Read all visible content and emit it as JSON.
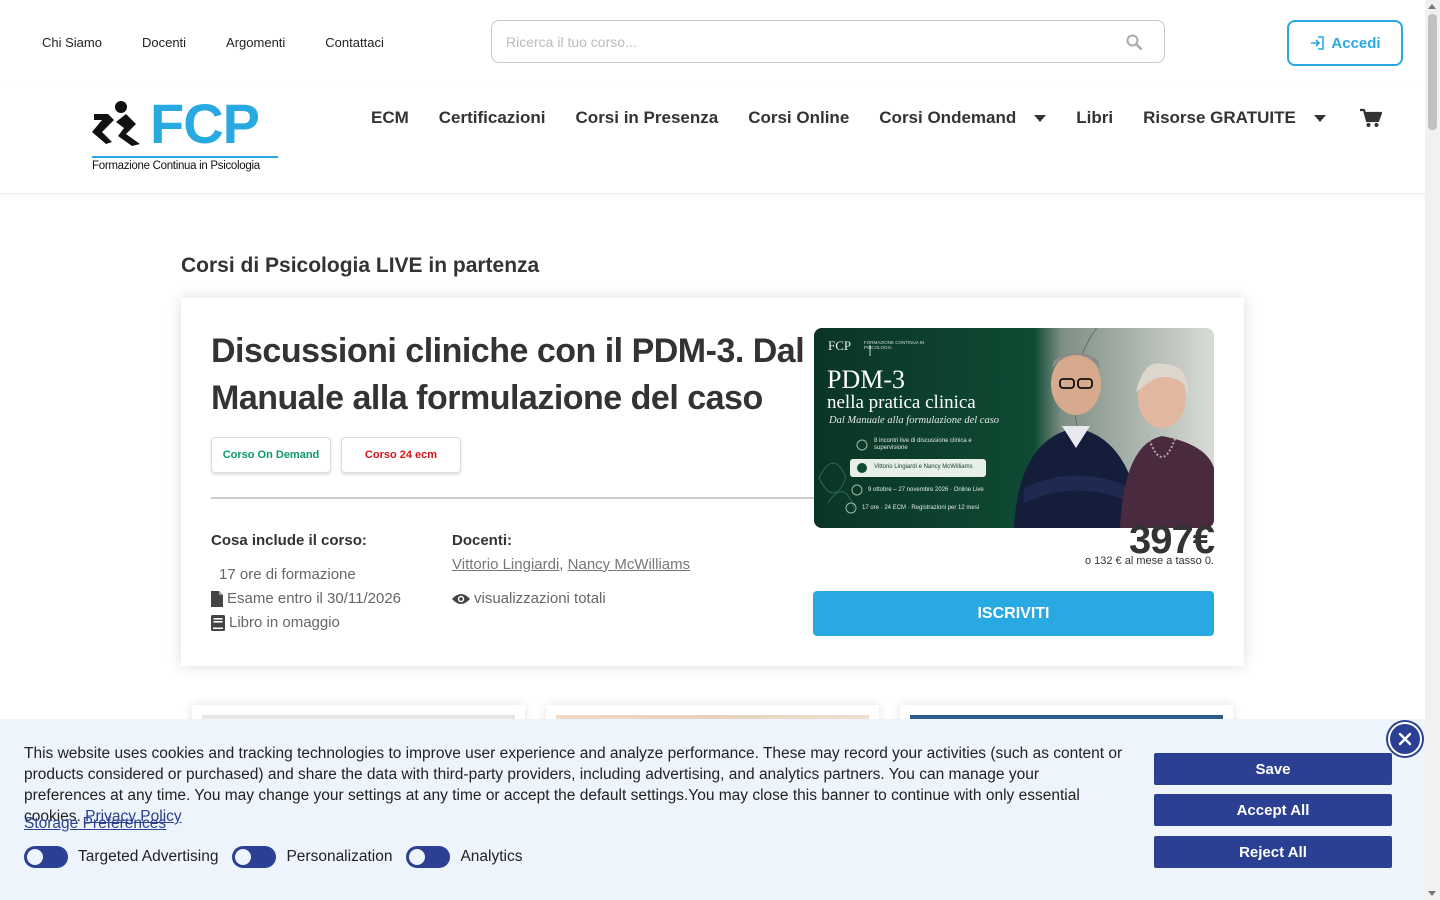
{
  "toplinks": [
    "Chi Siamo",
    "Docenti",
    "Argomenti",
    "Contattaci"
  ],
  "search": {
    "placeholder": "Ricerca il tuo corso..."
  },
  "account": {
    "login_label": "Accedi"
  },
  "logo": {
    "wordmark": "FCP",
    "tagline": "Formazione Continua in Psicologia"
  },
  "nav": {
    "ecm": "ECM",
    "certificazioni": "Certificazioni",
    "presenza": "Corsi in Presenza",
    "online": "Corsi Online",
    "ondemand": "Corsi Ondemand",
    "libri": "Libri",
    "risorse": "Risorse GRATUITE"
  },
  "section": {
    "title": "Corsi di Psicologia LIVE in partenza"
  },
  "course": {
    "title": "Discussioni cliniche con il PDM-3. Dal Manuale alla formulazione del caso",
    "badge_type": "Corso On Demand",
    "badge_ecm": "Corso 24 ecm",
    "includes_heading": "Cosa include il corso:",
    "hours": "17 ore di formazione",
    "exam": "Esame entro il 30/11/2026",
    "book": "Libro in omaggio",
    "teachers_heading": "Docenti:",
    "teacher1": "Vittorio Lingiardi",
    "teacher_sep": ", ",
    "teacher2": "Nancy McWilliams",
    "views": "visualizzazioni totali",
    "price": "397€",
    "installment": "o 132 € al mese a tasso 0.",
    "cta": "ISCRIVITI",
    "image": {
      "brand": "FCP",
      "brand_sub": "FORMAZIONE CONTINUA IN PSICOLOGIA",
      "headline1": "PDM-3",
      "headline2": "nella pratica clinica",
      "subtitle": "Dal Manuale alla formulazione del caso",
      "line1": "8 incontri live di discussione clinica e supervisione",
      "line2": "Vittorio Lingiardi e Nancy McWilliams",
      "line3": "9 ottobre – 27 novembre 2026 · Online Live",
      "line4": "17 ore · 24 ECM · Registrazioni per 12 mesi"
    }
  },
  "cookie": {
    "text": "This website uses cookies and tracking technologies to improve user experience and analyze performance. These may record your activities (such as content or products considered or purchased) and share the data with third-party providers, including advertising, and analytics partners. You can manage your preferences at any time. You may change your settings at any time or accept the default settings.You may close this banner to continue with only essential cookies. ",
    "privacy_link": "Privacy Policy",
    "storage_link": "Storage Preferences",
    "toggle1": "Targeted Advertising",
    "toggle2": "Personalization",
    "toggle3": "Analytics",
    "save": "Save",
    "accept": "Accept All",
    "reject": "Reject All"
  },
  "colors": {
    "accent": "#29a9e1",
    "cookie_button": "#2b3f93",
    "ondemand_badge": "#0a9a6a",
    "ecm_badge": "#d7141a"
  }
}
